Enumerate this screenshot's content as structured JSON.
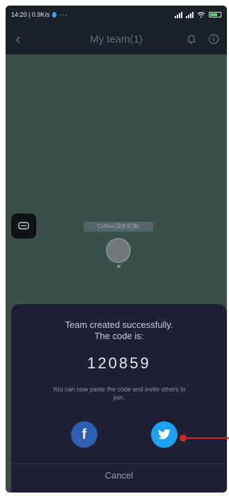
{
  "status_bar": {
    "time_info": "14:20 | 0.9K/s",
    "dots": "···"
  },
  "nav": {
    "back_icon": "‹",
    "title": "My team(1)"
  },
  "map": {
    "member_label": "Coffee(滑步先锋)"
  },
  "sheet": {
    "message_line1": "Team created successfully.",
    "message_line2": "The code is:",
    "code": "120859",
    "hint": "You can now paste the code and invite others to join.",
    "facebook_glyph": "f",
    "cancel_label": "Cancel"
  },
  "colors": {
    "status_bg": "#17212a",
    "map_bg": "#3b4f4a",
    "sheet_bg": "#1e2133",
    "facebook": "#2f5fb3",
    "twitter": "#1da1f2",
    "pointer": "#d22828"
  }
}
